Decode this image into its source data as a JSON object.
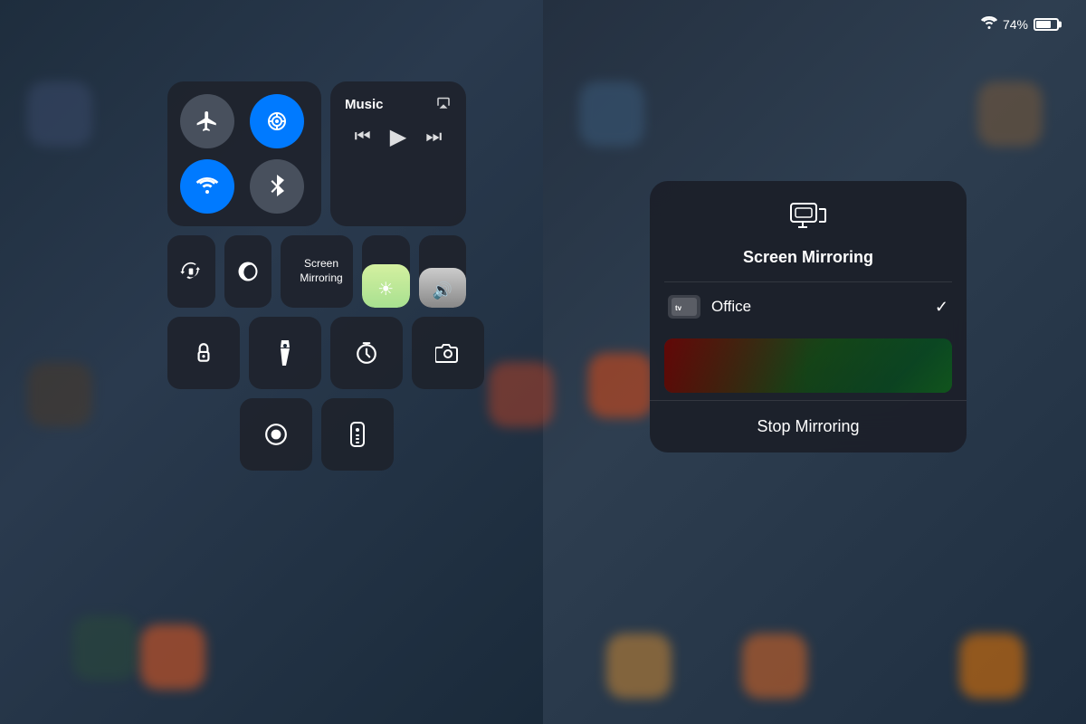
{
  "statusBar": {
    "battery": "74%",
    "wifi": "wifi"
  },
  "controlCenter": {
    "connectivity": {
      "buttons": [
        {
          "id": "airplane",
          "icon": "✈",
          "active": false,
          "label": "Airplane Mode"
        },
        {
          "id": "cellular",
          "icon": "📡",
          "active": true,
          "label": "Cellular"
        },
        {
          "id": "wifi",
          "icon": "📶",
          "active": true,
          "label": "Wi-Fi"
        },
        {
          "id": "bluetooth",
          "icon": "🔵",
          "active": false,
          "label": "Bluetooth"
        }
      ]
    },
    "music": {
      "title": "Music",
      "controls": [
        "⏮",
        "▶",
        "⏭"
      ]
    },
    "middleButtons": [
      {
        "id": "rotation-lock",
        "icon": "🔄",
        "label": "Rotation Lock"
      },
      {
        "id": "do-not-disturb",
        "icon": "🌙",
        "label": "Do Not Disturb"
      }
    ],
    "screenMirroring": {
      "icon": "▭",
      "label": "Screen\nMirroring"
    },
    "sliders": [
      {
        "id": "brightness",
        "icon": "☀",
        "type": "brightness"
      },
      {
        "id": "volume",
        "icon": "🔊",
        "type": "volume"
      }
    ],
    "bottomButtons": [
      {
        "id": "lock",
        "icon": "🔒",
        "label": ""
      },
      {
        "id": "flashlight",
        "icon": "🔦",
        "label": ""
      },
      {
        "id": "timer",
        "icon": "⏱",
        "label": ""
      },
      {
        "id": "camera",
        "icon": "📷",
        "label": ""
      }
    ],
    "lastRow": [
      {
        "id": "record",
        "icon": "⏺",
        "label": "Screen Record"
      },
      {
        "id": "remote",
        "icon": "🎮",
        "label": "Remote"
      }
    ]
  },
  "mirroringDialog": {
    "icon": "⧉",
    "title": "Screen Mirroring",
    "options": [
      {
        "id": "office",
        "name": "Office",
        "appletvLabel": "tv",
        "selected": true
      }
    ],
    "stopButton": "Stop Mirroring"
  }
}
